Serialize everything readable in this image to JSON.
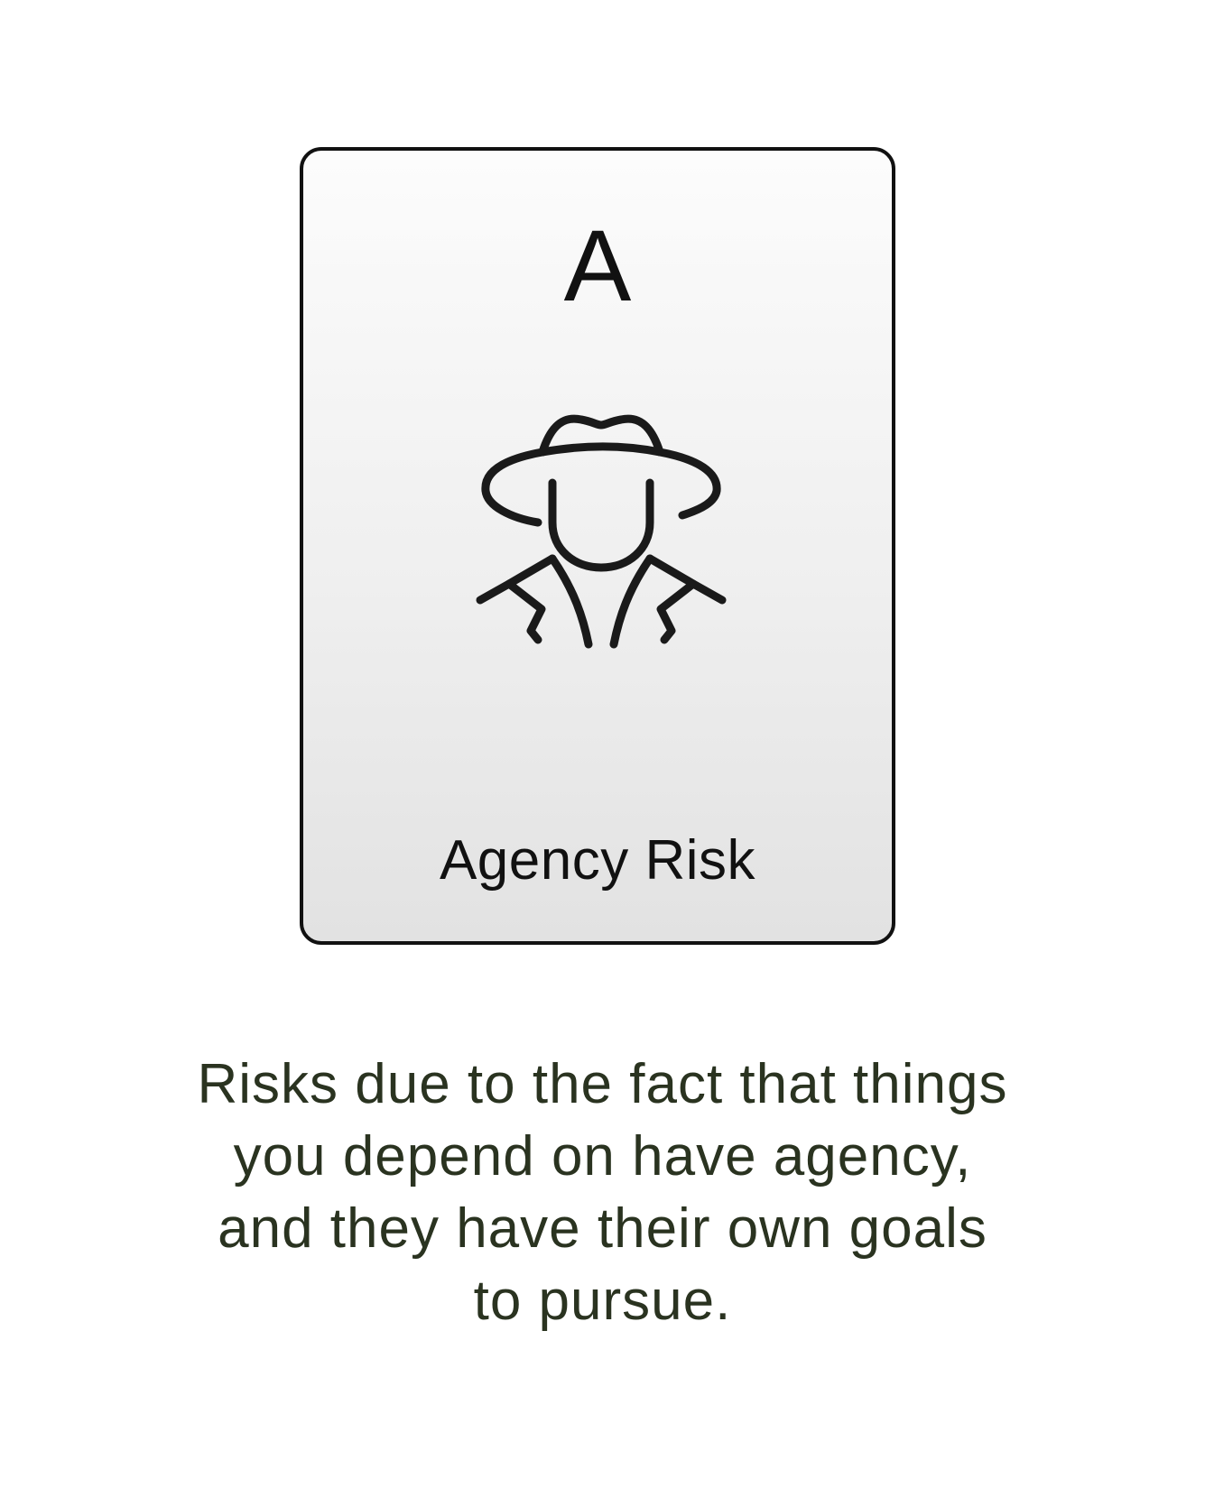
{
  "card": {
    "letter": "A",
    "icon": "spy-agent-icon",
    "title": "Agency Risk"
  },
  "description": {
    "lines": [
      "Risks due to the fact that things",
      "you depend on have agency,",
      "and they have their own goals",
      "to pursue."
    ]
  },
  "colors": {
    "card_border": "#111111",
    "icon_stroke": "#1a1a1a",
    "description_text": "#2a3320"
  }
}
